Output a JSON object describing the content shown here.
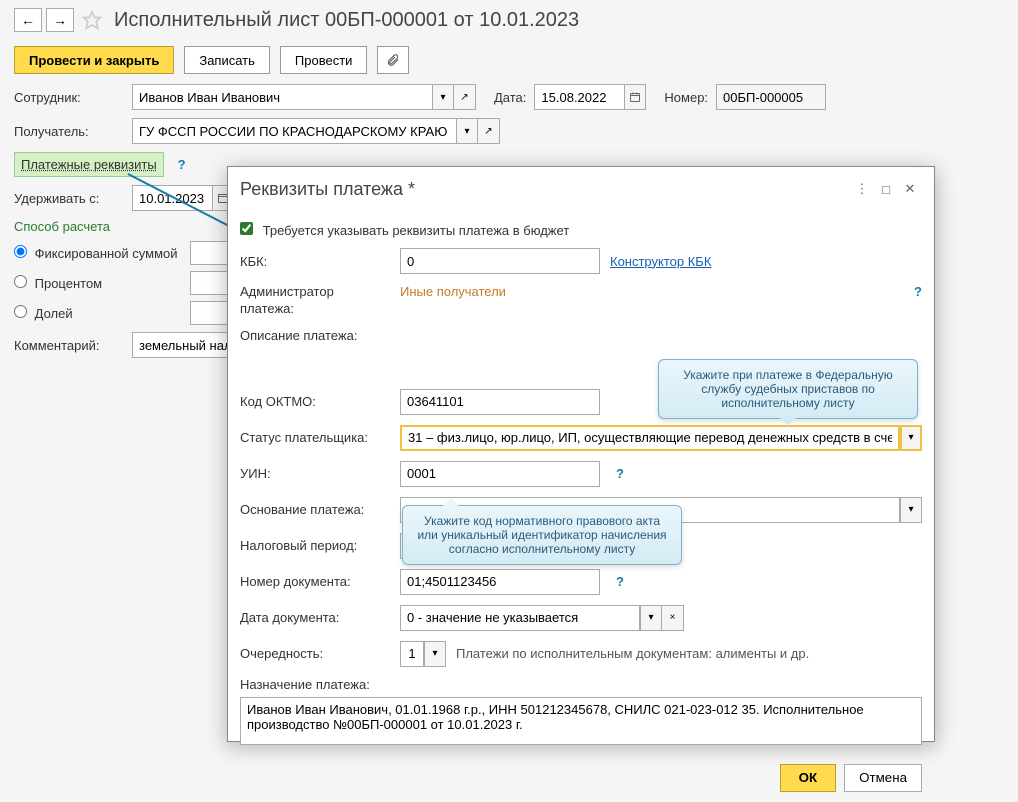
{
  "nav": {
    "back": "←",
    "forward": "→"
  },
  "page_title": "Исполнительный лист 00БП-000001 от 10.01.2023",
  "buttons": {
    "post_close": "Провести и закрыть",
    "save": "Записать",
    "post": "Провести"
  },
  "form": {
    "employee_label": "Сотрудник:",
    "employee": "Иванов Иван Иванович",
    "date_label": "Дата:",
    "date": "15.08.2022",
    "number_label": "Номер:",
    "number": "00БП-000005",
    "recipient_label": "Получатель:",
    "recipient": "ГУ ФССП РОССИИ ПО КРАСНОДАРСКОМУ КРАЮ Примс",
    "payment_link": "Платежные реквизиты",
    "withhold_label": "Удерживать с:",
    "withhold_date": "10.01.2023",
    "calc_method_label": "Способ расчета",
    "radio_fixed": "Фиксированной суммой",
    "radio_percent": "Процентом",
    "radio_share": "Долей",
    "comment_label": "Комментарий:",
    "comment": "земельный налог"
  },
  "dialog": {
    "title": "Реквизиты платежа *",
    "checkbox": "Требуется указывать реквизиты платежа в бюджет",
    "kbk_label": "КБК:",
    "kbk": "0",
    "kbk_link": "Конструктор КБК",
    "admin_label": "Администратор платежа:",
    "admin_value": "Иные получатели",
    "desc_label": "Описание платежа:",
    "oktmo_label": "Код ОКТМО:",
    "oktmo": "03641101",
    "status_label": "Статус плательщика:",
    "status": "31 – физ.лицо, юр.лицо, ИП, осуществляющие перевод денежных средств в сче",
    "uin_label": "УИН:",
    "uin": "0001",
    "basis_label": "Основание платежа:",
    "period_label": "Налоговый период:",
    "docnum_label": "Номер документа:",
    "docnum": "01;4501123456",
    "docdate_label": "Дата документа:",
    "docdate": "0 - значение не указывается",
    "priority_label": "Очередность:",
    "priority": "1",
    "priority_text": "Платежи по исполнительным документам: алименты и др.",
    "purpose_label": "Назначение платежа:",
    "purpose": "Иванов Иван Иванович, 01.01.1968 г.р., ИНН 501212345678, СНИЛС 021-023-012 35. Исполнительное производство №00БП-000001 от 10.01.2023 г.",
    "ok": "ОК",
    "cancel": "Отмена",
    "tooltip1": "Укажите при платеже в Федеральную службу судебных приставов по исполнительному листу",
    "tooltip2": "Укажите код нормативного правового акта или уникальный идентификатор начисления согласно исполнительному листу"
  }
}
